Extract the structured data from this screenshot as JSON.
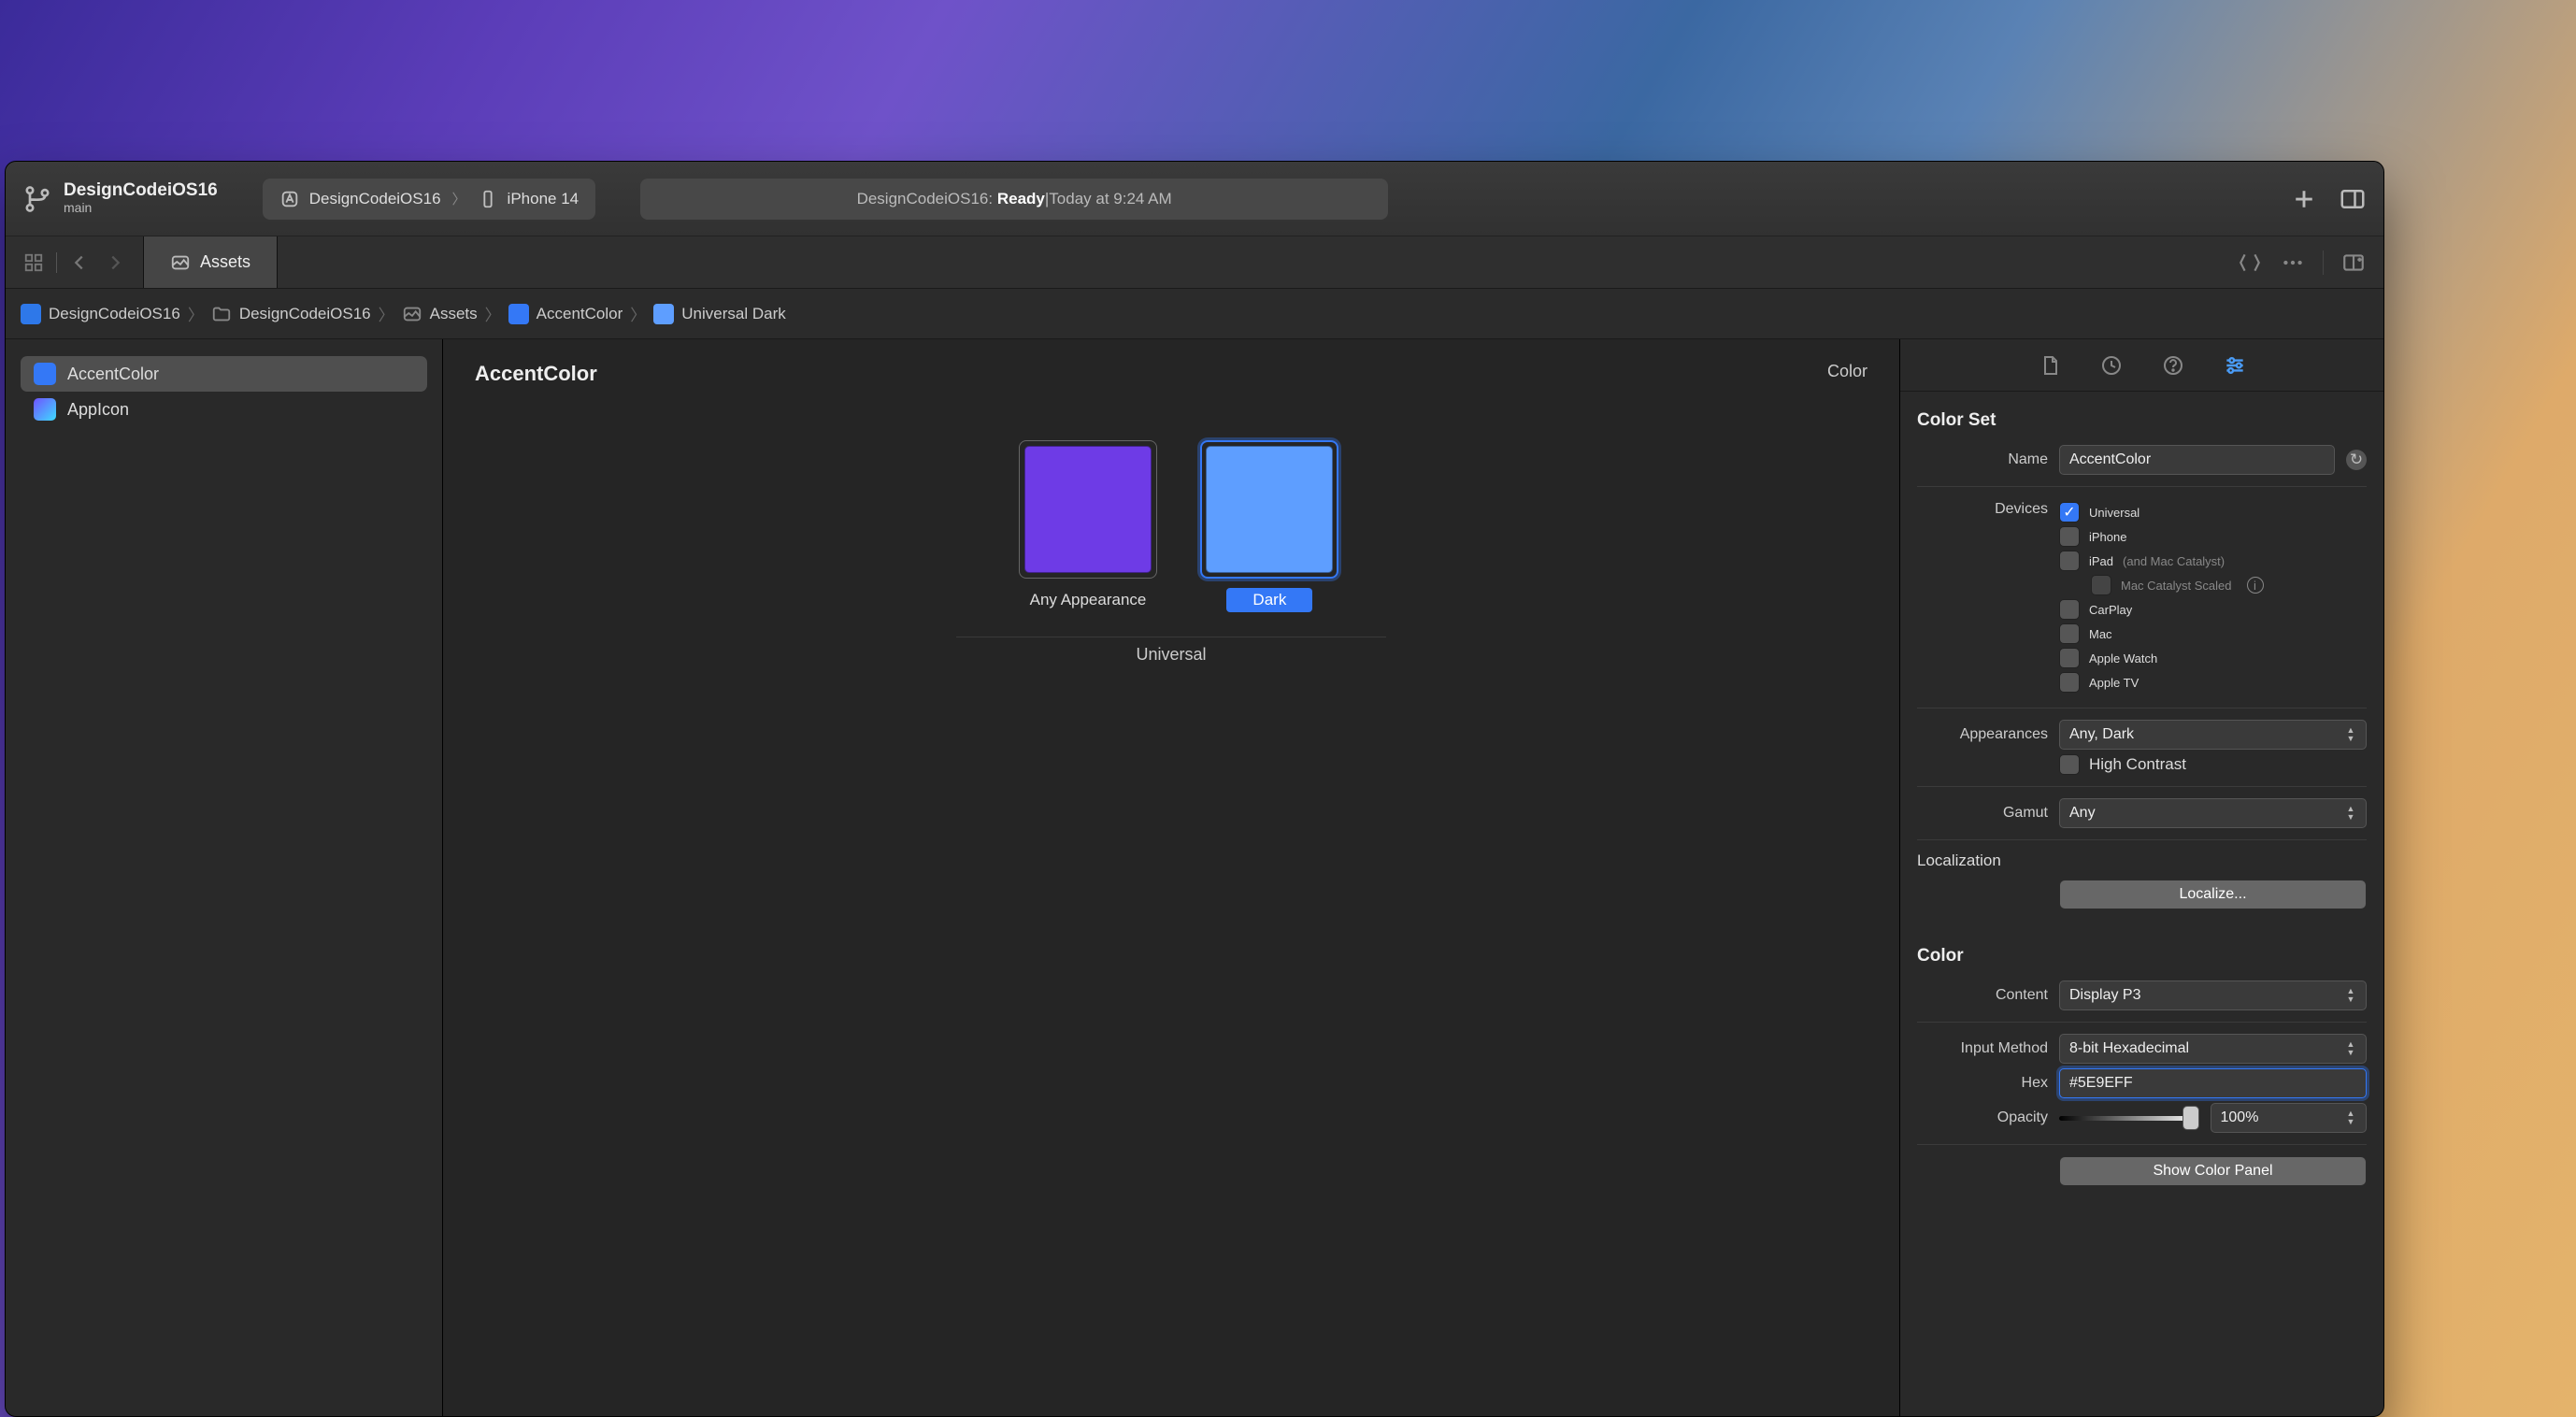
{
  "project": {
    "name": "DesignCodeiOS16",
    "branch": "main"
  },
  "scheme": {
    "project": "DesignCodeiOS16",
    "device": "iPhone 14"
  },
  "status": {
    "project": "DesignCodeiOS16:",
    "state": "Ready",
    "separator": " | ",
    "time": "Today at 9:24 AM"
  },
  "tab": {
    "label": "Assets"
  },
  "breadcrumbs": [
    {
      "icon": "project-icon",
      "label": "DesignCodeiOS16"
    },
    {
      "icon": "folder-icon",
      "label": "DesignCodeiOS16"
    },
    {
      "icon": "assets-icon",
      "label": "Assets"
    },
    {
      "icon": "color-swatch",
      "label": "AccentColor"
    },
    {
      "icon": "color-swatch",
      "label": "Universal Dark"
    }
  ],
  "sidebar": {
    "items": [
      {
        "name": "AccentColor",
        "color": "#3478F6",
        "active": true
      },
      {
        "name": "AppIcon",
        "color": "#6F52FF",
        "active": false
      }
    ]
  },
  "editor": {
    "title": "AccentColor",
    "top_right_label": "Color",
    "swatches": [
      {
        "label": "Any Appearance",
        "color": "#6E3BE6",
        "selected": false
      },
      {
        "label": "Dark",
        "color": "#5E9EFF",
        "selected": true
      }
    ],
    "group_label": "Universal"
  },
  "inspector": {
    "section1_title": "Color Set",
    "name_label": "Name",
    "name_value": "AccentColor",
    "devices_label": "Devices",
    "devices": [
      {
        "label": "Universal",
        "checked": true
      },
      {
        "label": "iPhone",
        "checked": false
      },
      {
        "label": "iPad",
        "note": "(and Mac Catalyst)",
        "checked": false
      },
      {
        "label": "Mac Catalyst Scaled",
        "checked": false,
        "inset": true,
        "info": true
      },
      {
        "label": "CarPlay",
        "checked": false
      },
      {
        "label": "Mac",
        "checked": false
      },
      {
        "label": "Apple Watch",
        "checked": false
      },
      {
        "label": "Apple TV",
        "checked": false
      }
    ],
    "appearances_label": "Appearances",
    "appearances_value": "Any, Dark",
    "high_contrast_label": "High Contrast",
    "gamut_label": "Gamut",
    "gamut_value": "Any",
    "localization_label": "Localization",
    "localize_button": "Localize...",
    "section2_title": "Color",
    "content_label": "Content",
    "content_value": "Display P3",
    "input_method_label": "Input Method",
    "input_method_value": "8-bit Hexadecimal",
    "hex_label": "Hex",
    "hex_value": "#5E9EFF",
    "opacity_label": "Opacity",
    "opacity_value": "100%",
    "show_color_panel": "Show Color Panel"
  },
  "colors": {
    "accent": "#3478F6",
    "swatch_any": "#6E3BE6",
    "swatch_dark": "#5E9EFF"
  }
}
